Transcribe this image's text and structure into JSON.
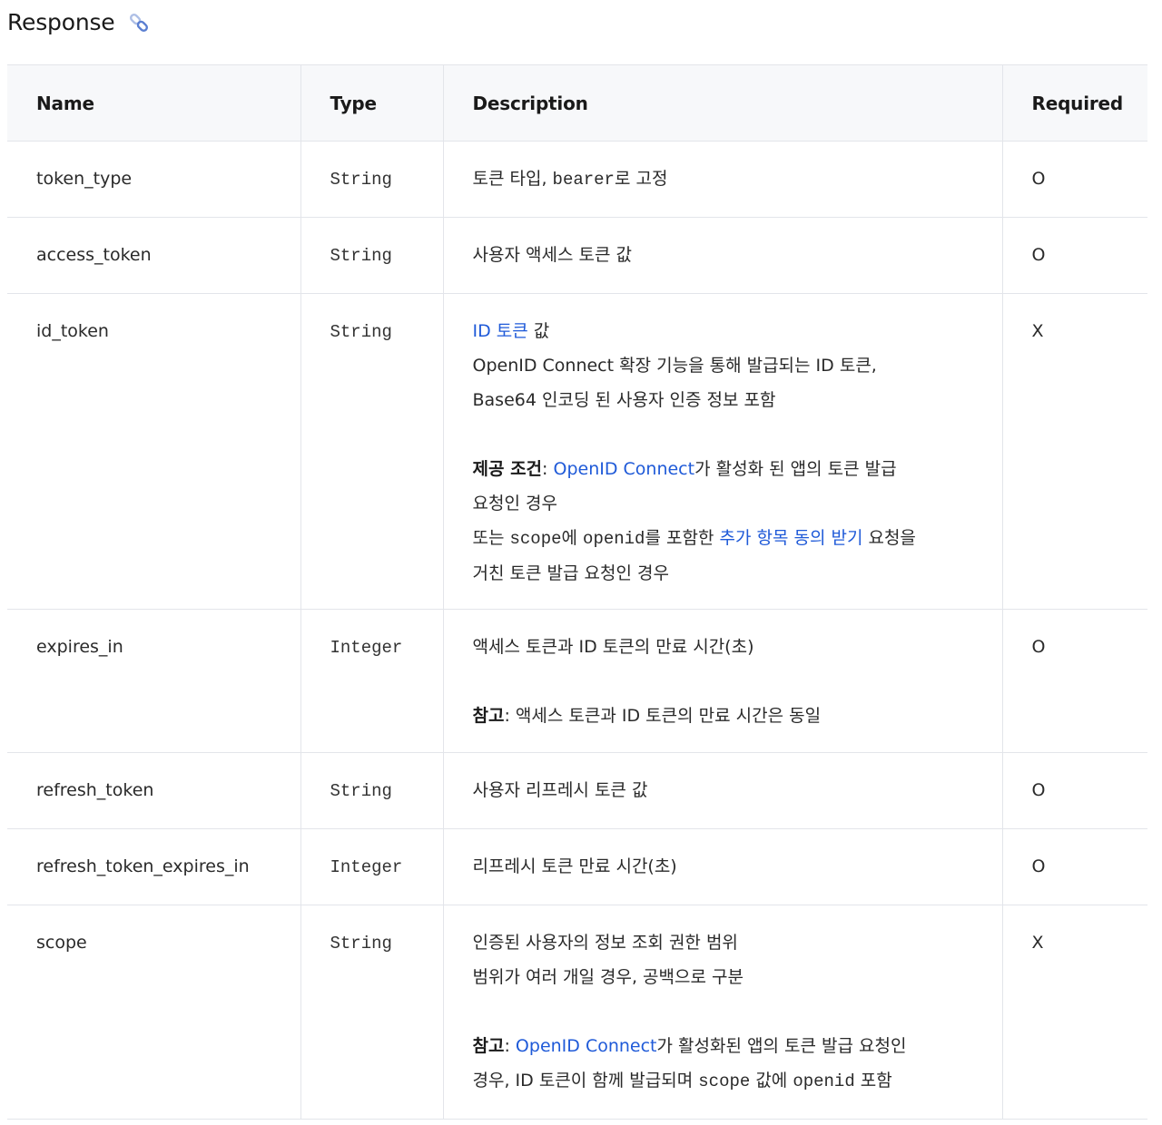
{
  "heading": {
    "title": "Response",
    "icon": "link-icon"
  },
  "table": {
    "headers": {
      "name": "Name",
      "type": "Type",
      "description": "Description",
      "required": "Required"
    },
    "rows": [
      {
        "name": "token_type",
        "type": "String",
        "desc_pre": "토큰 타입, ",
        "desc_code": "bearer",
        "desc_post": "로 고정",
        "required": "O"
      },
      {
        "name": "access_token",
        "type": "String",
        "desc": "사용자 액세스 토큰 값",
        "required": "O"
      },
      {
        "name": "id_token",
        "type": "String",
        "desc_link": "ID 토큰",
        "desc_after_link": " 값",
        "desc_line2": "OpenID Connect 확장 기능을 통해 발급되는 ID 토큰,",
        "desc_line3": "Base64 인코딩 된 사용자 인증 정보 포함",
        "cond_label": "제공 조건",
        "cond_colon": ": ",
        "cond_link": "OpenID Connect",
        "cond_text1": "가 활성화 된 앱의 토큰 발급",
        "cond_text2": "요청인 경우",
        "or_pre": "또는 ",
        "or_code1": "scope",
        "or_mid1": "에 ",
        "or_code2": "openid",
        "or_mid2": "를 포함한 ",
        "or_link": "추가 항목 동의 받기",
        "or_post": " 요청을",
        "or_line2": "거친 토큰 발급 요청인 경우",
        "required": "X"
      },
      {
        "name": "expires_in",
        "type": "Integer",
        "desc": "액세스 토큰과 ID 토큰의 만료 시간(초)",
        "note_label": "참고",
        "note_text": ": 액세스 토큰과 ID 토큰의 만료 시간은 동일",
        "required": "O"
      },
      {
        "name": "refresh_token",
        "type": "String",
        "desc": "사용자 리프레시 토큰 값",
        "required": "O"
      },
      {
        "name": "refresh_token_expires_in",
        "type": "Integer",
        "desc": "리프레시 토큰 만료 시간(초)",
        "required": "O"
      },
      {
        "name": "scope",
        "type": "String",
        "desc_line1": "인증된 사용자의 정보 조회 권한 범위",
        "desc_line2": "범위가 여러 개일 경우, 공백으로 구분",
        "note_label": "참고",
        "note_colon": ": ",
        "note_link": "OpenID Connect",
        "note_text1": "가 활성화된 앱의 토큰 발급 요청인",
        "note_text2_pre": "경우, ID 토큰이 함께 발급되며 ",
        "note_code1": "scope",
        "note_text2_mid": " 값에 ",
        "note_code2": "openid",
        "note_text2_post": " 포함",
        "required": "X"
      }
    ]
  },
  "colors": {
    "link": "#1f5ad8",
    "header_bg": "#f7f8fa",
    "border": "#e3e5ea"
  }
}
